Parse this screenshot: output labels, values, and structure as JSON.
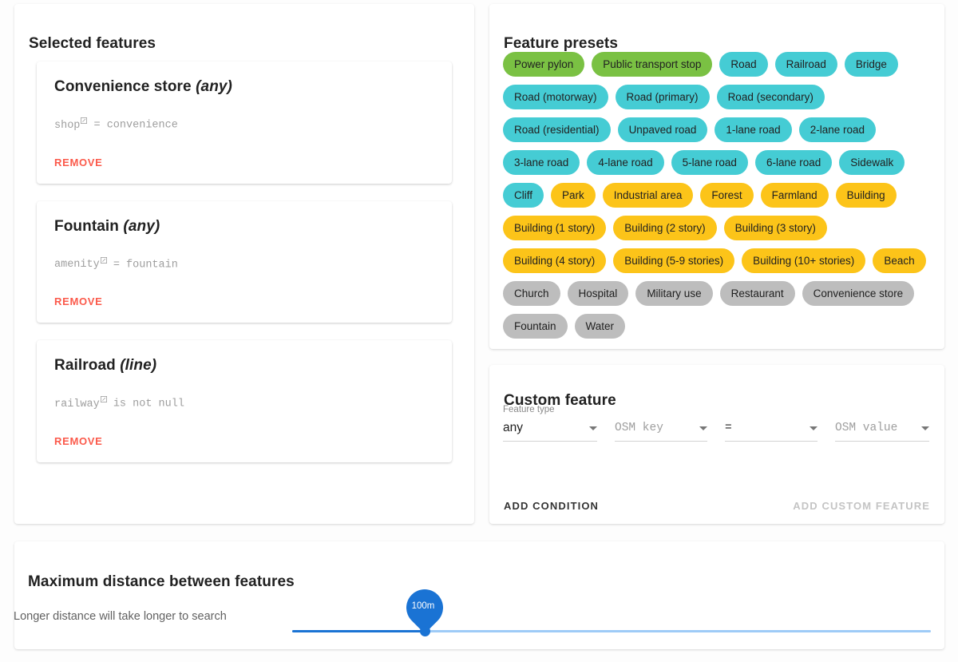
{
  "selected_features": {
    "title": "Selected features",
    "cards": [
      {
        "name": "Convenience store",
        "geometry": "(any)",
        "tag_key": "shop",
        "expression": " = convenience",
        "remove_label": "REMOVE"
      },
      {
        "name": "Fountain",
        "geometry": "(any)",
        "tag_key": "amenity",
        "expression": " = fountain",
        "remove_label": "REMOVE"
      },
      {
        "name": "Railroad",
        "geometry": "(line)",
        "tag_key": "railway",
        "expression": " is not null",
        "remove_label": "REMOVE"
      }
    ]
  },
  "feature_presets": {
    "title": "Feature presets",
    "colors": {
      "green": "#7ac143",
      "cyan": "#45ccd4",
      "amber": "#fcc419",
      "grey": "#bdbdbd"
    },
    "chips": [
      {
        "label": "Power pylon",
        "color": "green"
      },
      {
        "label": "Public transport stop",
        "color": "green"
      },
      {
        "label": "Road",
        "color": "cyan"
      },
      {
        "label": "Railroad",
        "color": "cyan"
      },
      {
        "label": "Bridge",
        "color": "cyan"
      },
      {
        "label": "Road (motorway)",
        "color": "cyan"
      },
      {
        "label": "Road (primary)",
        "color": "cyan"
      },
      {
        "label": "Road (secondary)",
        "color": "cyan"
      },
      {
        "label": "Road (residential)",
        "color": "cyan"
      },
      {
        "label": "Unpaved road",
        "color": "cyan"
      },
      {
        "label": "1-lane road",
        "color": "cyan"
      },
      {
        "label": "2-lane road",
        "color": "cyan"
      },
      {
        "label": "3-lane road",
        "color": "cyan"
      },
      {
        "label": "4-lane road",
        "color": "cyan"
      },
      {
        "label": "5-lane road",
        "color": "cyan"
      },
      {
        "label": "6-lane road",
        "color": "cyan"
      },
      {
        "label": "Sidewalk",
        "color": "cyan"
      },
      {
        "label": "Cliff",
        "color": "cyan"
      },
      {
        "label": "Park",
        "color": "amber"
      },
      {
        "label": "Industrial area",
        "color": "amber"
      },
      {
        "label": "Forest",
        "color": "amber"
      },
      {
        "label": "Farmland",
        "color": "amber"
      },
      {
        "label": "Building",
        "color": "amber"
      },
      {
        "label": "Building (1 story)",
        "color": "amber"
      },
      {
        "label": "Building (2 story)",
        "color": "amber"
      },
      {
        "label": "Building (3 story)",
        "color": "amber"
      },
      {
        "label": "Building (4 story)",
        "color": "amber"
      },
      {
        "label": "Building (5-9 stories)",
        "color": "amber"
      },
      {
        "label": "Building (10+ stories)",
        "color": "amber"
      },
      {
        "label": "Beach",
        "color": "amber"
      },
      {
        "label": "Church",
        "color": "grey"
      },
      {
        "label": "Hospital",
        "color": "grey"
      },
      {
        "label": "Military use",
        "color": "grey"
      },
      {
        "label": "Restaurant",
        "color": "grey"
      },
      {
        "label": "Convenience store",
        "color": "grey"
      },
      {
        "label": "Fountain",
        "color": "grey"
      },
      {
        "label": "Water",
        "color": "grey"
      }
    ]
  },
  "custom_feature": {
    "title": "Custom feature",
    "feature_type_label": "Feature type",
    "feature_type_value": "any",
    "osm_key_placeholder": "OSM key",
    "operator_value": "=",
    "osm_value_placeholder": "OSM value",
    "add_condition_label": "ADD CONDITION",
    "add_custom_feature_label": "ADD CUSTOM FEATURE"
  },
  "distance": {
    "title": "Maximum distance between features",
    "hint": "Longer distance will take longer to search",
    "value_label": "100m"
  }
}
